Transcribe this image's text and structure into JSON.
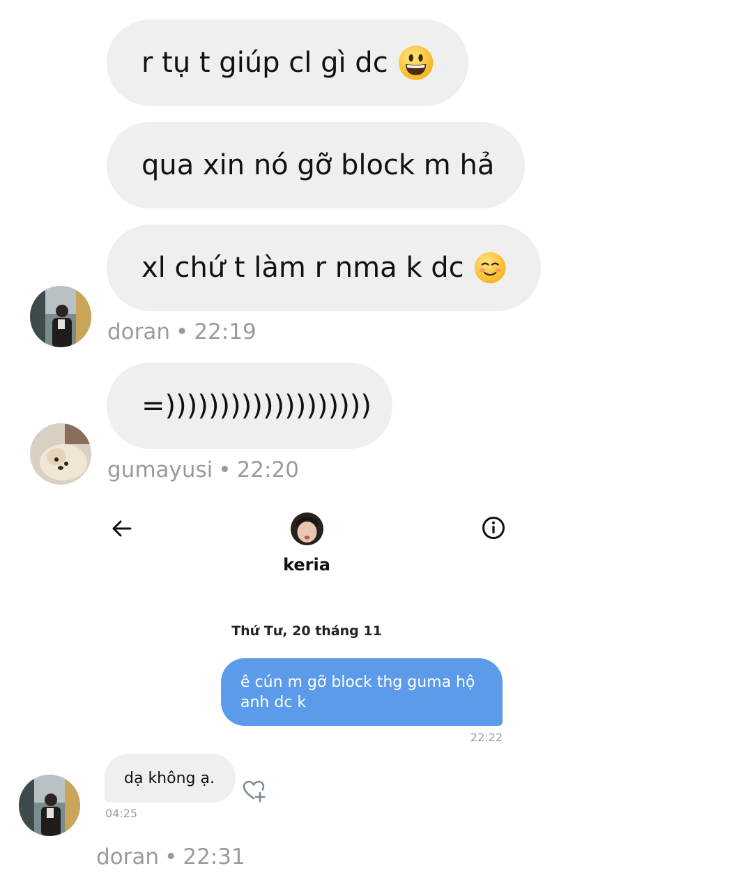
{
  "thread": {
    "messages": [
      {
        "text": "r tụ t giúp cl gì dc",
        "emoji": "grinning-face-emoji"
      },
      {
        "text": "qua xin nó gỡ block m hả"
      },
      {
        "text": "xl chứ t làm r nma k dc",
        "emoji": "smiling-face-emoji"
      }
    ],
    "meta1": {
      "user": "doran",
      "time": "22:19"
    },
    "reply": {
      "text": "=)))))))))))))))))))"
    },
    "meta2": {
      "user": "gumayusi",
      "time": "22:20"
    },
    "meta3": {
      "user": "doran",
      "time": "22:31"
    }
  },
  "embedded": {
    "header": {
      "name": "keria",
      "back_icon": "arrow-left-icon",
      "info_icon": "info-icon"
    },
    "date_label": "Thứ Tư, 20 tháng 11",
    "sent": {
      "text": "ê cún m gỡ block thg guma hộ anh dc k",
      "time": "22:22",
      "color": "#5b9bea"
    },
    "received": {
      "text": "dạ không ạ.",
      "time": "04:25",
      "react_icon": "heart-plus-icon"
    }
  },
  "separator": "•"
}
